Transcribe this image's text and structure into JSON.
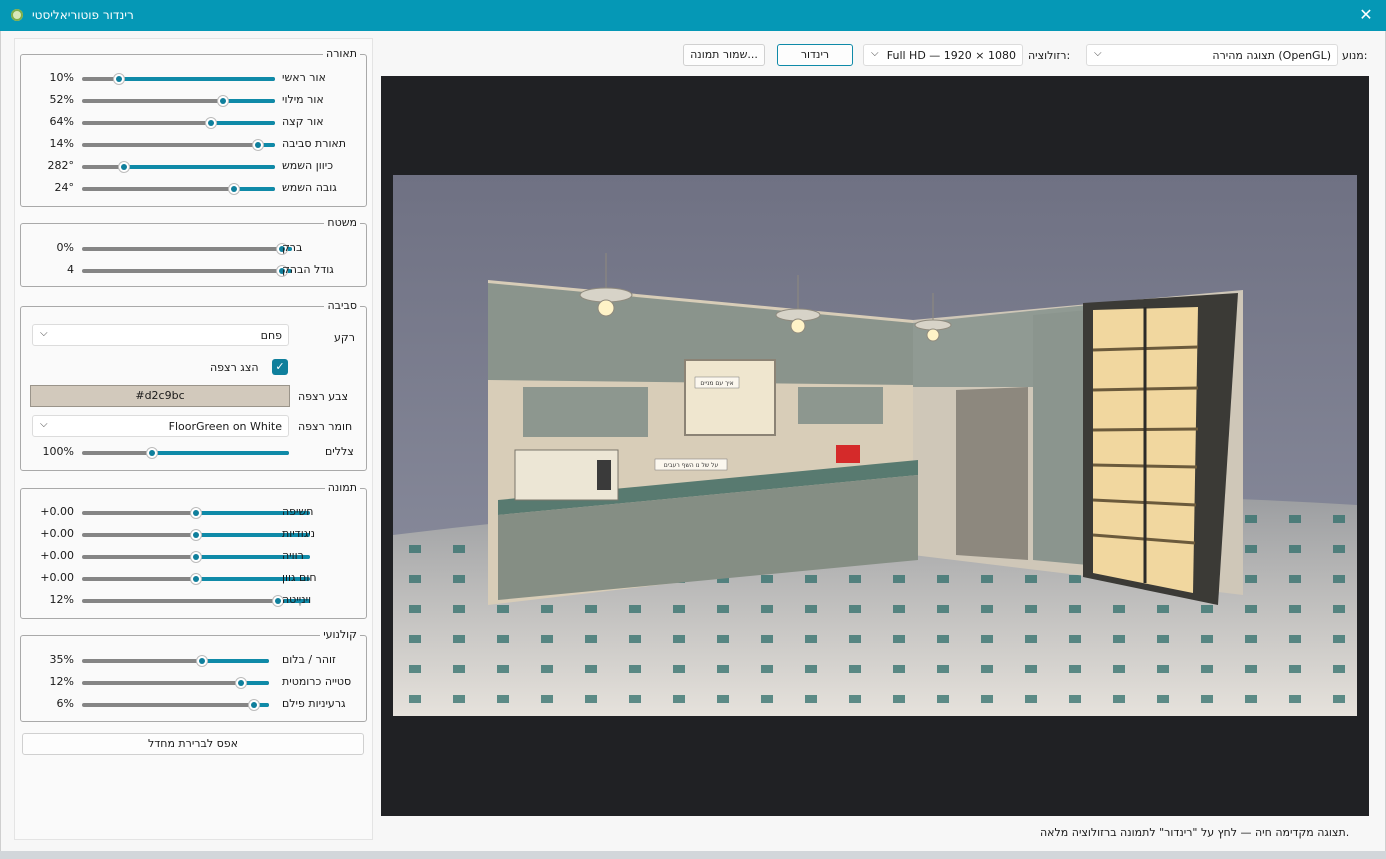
{
  "window": {
    "title": "רינדור פוטוריאליסטי",
    "close_icon": "close-icon"
  },
  "toolbar": {
    "engine_label": "מנוע:",
    "engine_value": "תצוגה מהירה (OpenGL)",
    "resolution_label": "רזולוציה:",
    "resolution_value": "Full HD — 1920 × 1080",
    "render_button": "רינדור",
    "save_button": "שמור תמונה..."
  },
  "groups": {
    "lighting": {
      "title": "תאורה",
      "sliders": [
        {
          "label": "אור ראשי",
          "value": "10%",
          "level": 0.81
        },
        {
          "label": "אור מילוי",
          "value": "52%",
          "level": 0.27
        },
        {
          "label": "אור קצה",
          "value": "64%",
          "level": 0.33
        },
        {
          "label": "תאורת סביבה",
          "value": "14%",
          "level": 0.09
        },
        {
          "label": "כיוון השמש",
          "value": "282°",
          "level": 0.78
        },
        {
          "label": "גובה השמש",
          "value": "24°",
          "level": 0.21
        }
      ]
    },
    "surface": {
      "title": "משטח",
      "sliders": [
        {
          "label": "ברק",
          "value": "0%",
          "level": 0.05
        },
        {
          "label": "גודל הבהק",
          "value": "4",
          "level": 0.05
        }
      ]
    },
    "environment": {
      "title": "סביבה",
      "background_label": "רקע",
      "background_value": "פחם",
      "show_floor_label": "הצג רצפה",
      "show_floor_checked": true,
      "floor_color_label": "צבע רצפה",
      "floor_color_value": "#d2c9bc",
      "floor_material_label": "חומר רצפה",
      "floor_material_value": "FloorGreen on White",
      "shadows_label": "צללים",
      "shadows_value": "100%",
      "shadows_level": 0.66
    },
    "image": {
      "title": "תמונה",
      "sliders": [
        {
          "label": "חשיפה",
          "value": "+0.00",
          "level": 0.5
        },
        {
          "label": "ניגודיות",
          "value": "+0.00",
          "level": 0.5
        },
        {
          "label": "רוויה",
          "value": "+0.00",
          "level": 0.5
        },
        {
          "label": "חום גוון",
          "value": "+0.00",
          "level": 0.5
        },
        {
          "label": "ויניֶיטה",
          "value": "12%",
          "level": 0.14
        }
      ]
    },
    "cinematic": {
      "title": "קולנועי",
      "sliders": [
        {
          "label": "זוהר / בלום",
          "value": "35%",
          "level": 0.36
        },
        {
          "label": "סטייה כרומטית",
          "value": "12%",
          "level": 0.15
        },
        {
          "label": "גרעיניות פילם",
          "value": "6%",
          "level": 0.08
        }
      ]
    }
  },
  "reset_button": "אפס לברירת מחדל",
  "status": "תצוגה מקדימה חיה — לחץ על \"רינדור\" לתמונה ברזולוציה מלאה.",
  "scene": {
    "label_top": "איך עם מניים",
    "label_mid": "על של נו השף רעבים"
  },
  "colors": {
    "accent": "#0598b6",
    "slider": "#0f8aa8",
    "viewport": "#202124"
  }
}
